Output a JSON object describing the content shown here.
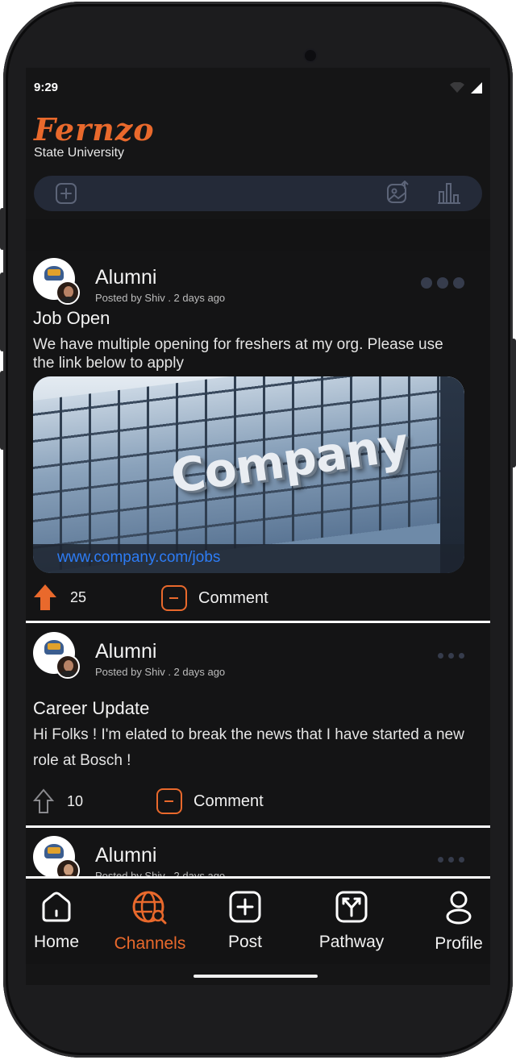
{
  "status": {
    "time": "9:29",
    "wifi_icon": "wifi-icon",
    "signal_icon": "signal-icon"
  },
  "brand": {
    "logo": "Fernzo",
    "subtitle": "State University"
  },
  "composer": {
    "add_icon": "add-square-icon",
    "image_icon": "image-upload-icon",
    "poll_icon": "bar-chart-icon"
  },
  "posts": [
    {
      "author": "Alumni",
      "meta": "Posted by Shiv . 2 days ago",
      "title": "Job Open",
      "body": "We have multiple opening  for freshers at my org. Please use the link below to apply",
      "link_image_text": "Company",
      "link_url": "www.company.com/jobs",
      "votes": "25",
      "voted": true,
      "comment_label": "Comment"
    },
    {
      "author": "Alumni",
      "meta": "Posted by Shiv . 2 days ago",
      "title": "Career Update",
      "body": "Hi Folks ! I'm elated to break the news that I have started a new role at Bosch !",
      "votes": "10",
      "voted": false,
      "comment_label": "Comment"
    },
    {
      "author": "Alumni",
      "meta": "Posted by Shiv . 2 days ago"
    }
  ],
  "tabs": [
    {
      "label": "Home",
      "icon": "home-icon",
      "active": false
    },
    {
      "label": "Channels",
      "icon": "globe-search-icon",
      "active": true
    },
    {
      "label": "Post",
      "icon": "plus-square-icon",
      "active": false
    },
    {
      "label": "Pathway",
      "icon": "fork-arrow-icon",
      "active": false
    },
    {
      "label": "Profile",
      "icon": "user-icon",
      "active": false
    }
  ],
  "colors": {
    "accent": "#e9692c",
    "background": "#151516",
    "link": "#2d7cf5"
  }
}
